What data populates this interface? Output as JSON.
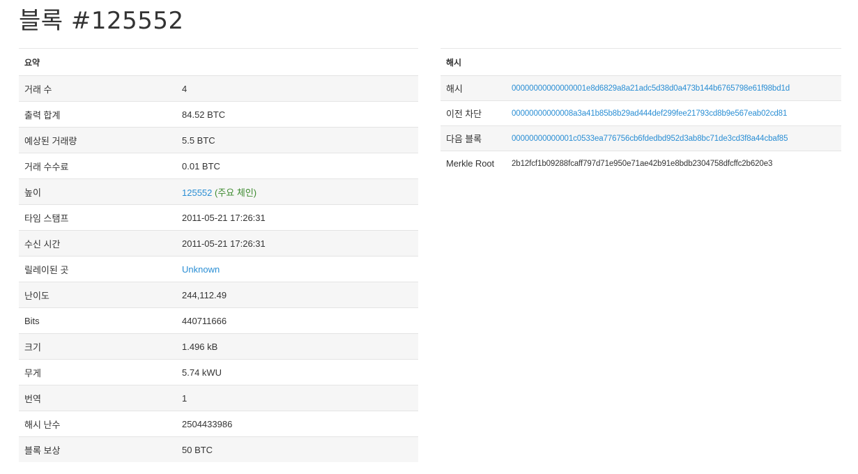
{
  "page": {
    "title": "블록 #125552"
  },
  "summary": {
    "heading": "요약",
    "rows": [
      {
        "label": "거래 수",
        "value": "4"
      },
      {
        "label": "출력 합계",
        "value": "84.52 BTC"
      },
      {
        "label": "예상된 거래량",
        "value": "5.5 BTC"
      },
      {
        "label": "거래 수수료",
        "value": "0.01 BTC"
      },
      {
        "label": "높이",
        "value": "125552",
        "note": "(주요 체인)"
      },
      {
        "label": "타임 스탬프",
        "value": "2011-05-21 17:26:31"
      },
      {
        "label": "수신 시간",
        "value": "2011-05-21 17:26:31"
      },
      {
        "label": "릴레이된 곳",
        "value": "Unknown"
      },
      {
        "label": "난이도",
        "value": "244,112.49"
      },
      {
        "label": "Bits",
        "value": "440711666"
      },
      {
        "label": "크기",
        "value": "1.496 kB"
      },
      {
        "label": "무게",
        "value": "5.74 kWU"
      },
      {
        "label": "번역",
        "value": "1"
      },
      {
        "label": "해시 난수",
        "value": "2504433986"
      },
      {
        "label": "블록 보상",
        "value": "50 BTC"
      }
    ]
  },
  "hashes": {
    "heading": "해시",
    "rows": [
      {
        "label": "해시",
        "value": "00000000000000001e8d6829a8a21adc5d38d0a473b144b6765798e61f98bd1d"
      },
      {
        "label": "이전 차단",
        "value": "00000000000008a3a41b85b8b29ad444def299fee21793cd8b9e567eab02cd81"
      },
      {
        "label": "다음 블록",
        "value": "00000000000001c0533ea776756cb6fdedbd952d3ab8bc71de3cd3f8a44cbaf85"
      },
      {
        "label": "Merkle Root",
        "value": "2b12fcf1b09288fcaff797d71e950e71ae42b91e8bdb2304758dfcffc2b620e3"
      }
    ]
  },
  "colors": {
    "link": "#2a8ed4",
    "main_chain": "#3c8a2e",
    "row_stripe": "#f6f6f6"
  }
}
